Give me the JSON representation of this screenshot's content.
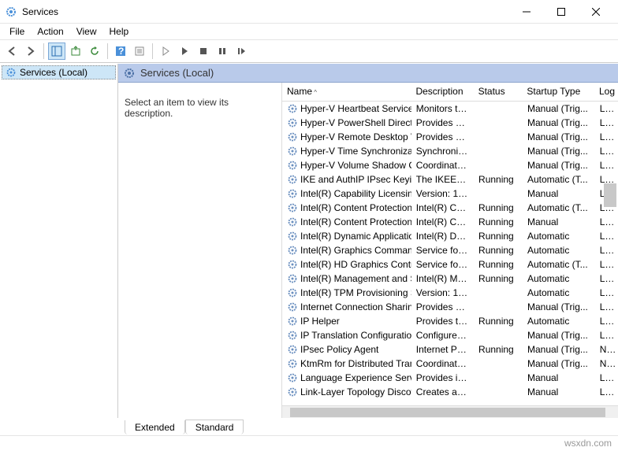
{
  "title": "Services",
  "menus": {
    "file": "File",
    "action": "Action",
    "view": "View",
    "help": "Help"
  },
  "tree": {
    "root": "Services (Local)"
  },
  "pane_header": "Services (Local)",
  "desc_prompt": "Select an item to view its description.",
  "columns": {
    "name": "Name",
    "desc": "Description",
    "status": "Status",
    "startup": "Startup Type",
    "logon": "Log"
  },
  "tabs": {
    "extended": "Extended",
    "standard": "Standard"
  },
  "footer": "wsxdn.com",
  "services": [
    {
      "name": "Hyper-V Heartbeat Service",
      "desc": "Monitors th...",
      "status": "",
      "startup": "Manual (Trig...",
      "logon": "Loca"
    },
    {
      "name": "Hyper-V PowerShell Direct ...",
      "desc": "Provides a ...",
      "status": "",
      "startup": "Manual (Trig...",
      "logon": "Loca"
    },
    {
      "name": "Hyper-V Remote Desktop Vi...",
      "desc": "Provides a p...",
      "status": "",
      "startup": "Manual (Trig...",
      "logon": "Loca"
    },
    {
      "name": "Hyper-V Time Synchronizati...",
      "desc": "Synchronize...",
      "status": "",
      "startup": "Manual (Trig...",
      "logon": "Loca"
    },
    {
      "name": "Hyper-V Volume Shadow C...",
      "desc": "Coordinates...",
      "status": "",
      "startup": "Manual (Trig...",
      "logon": "Loca"
    },
    {
      "name": "IKE and AuthIP IPsec Keying...",
      "desc": "The IKEEXT ...",
      "status": "Running",
      "startup": "Automatic (T...",
      "logon": "Loca"
    },
    {
      "name": "Intel(R) Capability Licensing...",
      "desc": "Version: 1.6...",
      "status": "",
      "startup": "Manual",
      "logon": "Loca"
    },
    {
      "name": "Intel(R) Content Protection ...",
      "desc": "Intel(R) Con...",
      "status": "Running",
      "startup": "Automatic (T...",
      "logon": "Loca"
    },
    {
      "name": "Intel(R) Content Protection ...",
      "desc": "Intel(R) Con...",
      "status": "Running",
      "startup": "Manual",
      "logon": "Loca"
    },
    {
      "name": "Intel(R) Dynamic Applicatio...",
      "desc": "Intel(R) Dyn...",
      "status": "Running",
      "startup": "Automatic",
      "logon": "Loca"
    },
    {
      "name": "Intel(R) Graphics Command...",
      "desc": "Service for I...",
      "status": "Running",
      "startup": "Automatic",
      "logon": "Loca"
    },
    {
      "name": "Intel(R) HD Graphics Contro...",
      "desc": "Service for I...",
      "status": "Running",
      "startup": "Automatic (T...",
      "logon": "Loca"
    },
    {
      "name": "Intel(R) Management and S...",
      "desc": "Intel(R) Ma...",
      "status": "Running",
      "startup": "Automatic",
      "logon": "Loca"
    },
    {
      "name": "Intel(R) TPM Provisioning S...",
      "desc": "Version: 1.6...",
      "status": "",
      "startup": "Automatic",
      "logon": "Loca"
    },
    {
      "name": "Internet Connection Sharin...",
      "desc": "Provides ne...",
      "status": "",
      "startup": "Manual (Trig...",
      "logon": "Loca"
    },
    {
      "name": "IP Helper",
      "desc": "Provides tu...",
      "status": "Running",
      "startup": "Automatic",
      "logon": "Loca"
    },
    {
      "name": "IP Translation Configuratio...",
      "desc": "Configures ...",
      "status": "",
      "startup": "Manual (Trig...",
      "logon": "Loca"
    },
    {
      "name": "IPsec Policy Agent",
      "desc": "Internet Pro...",
      "status": "Running",
      "startup": "Manual (Trig...",
      "logon": "Netw"
    },
    {
      "name": "KtmRm for Distributed Tran...",
      "desc": "Coordinates...",
      "status": "",
      "startup": "Manual (Trig...",
      "logon": "Netw"
    },
    {
      "name": "Language Experience Service",
      "desc": "Provides inf...",
      "status": "",
      "startup": "Manual",
      "logon": "Loca"
    },
    {
      "name": "Link-Layer Topology Discov...",
      "desc": "Creates a N...",
      "status": "",
      "startup": "Manual",
      "logon": "Loca"
    }
  ]
}
